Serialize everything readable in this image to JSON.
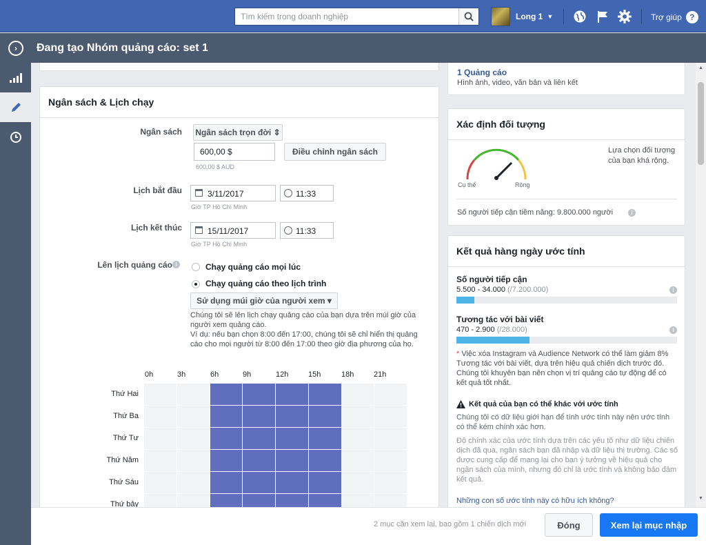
{
  "topbar": {
    "search_placeholder": "Tìm kiếm trong doanh nghiệp",
    "user_name": "Long 1",
    "help_label": "Trợ giúp"
  },
  "titlebar": {
    "title": "Đang tạo Nhóm quảng cáo: set 1"
  },
  "budget": {
    "heading": "Ngân sách & Lịch chạy",
    "budget_label": "Ngân sách",
    "budget_type": "Ngân sách trọn đời ⇕",
    "amount": "600,00 $",
    "amount_hint": "600,00 $ AUD",
    "adjust_button": "Điều chỉnh ngân sách",
    "start_label": "Lịch bắt đầu",
    "start_date": "3/11/2017",
    "start_time": "11:33",
    "start_tz": "Giờ TP Hồ Chí Minh",
    "end_label": "Lịch kết thúc",
    "end_date": "15/11/2017",
    "end_time": "11:33",
    "end_tz": "Giờ TP Hồ Chí Minh",
    "schedule_label": "Lên lịch quảng cáo",
    "option_always": "Chạy quảng cáo mọi lúc",
    "option_schedule": "Chạy quảng cáo theo lịch trình",
    "timezone_select": "Sử dụng múi giờ của người xem ▾",
    "desc1": "Chúng tôi sẽ lên lịch chạy quảng cáo của bạn dựa trên múi giờ của người xem quảng cáo.",
    "desc2": "Ví dụ: nếu bạn chọn 8:00 đến 17:00, chúng tôi sẽ chỉ hiển thị quảng cáo cho mọi người từ 8:00 đến 17:00 theo giờ địa phương của họ.",
    "hours": [
      "0h",
      "3h",
      "6h",
      "9h",
      "12h",
      "15h",
      "18h",
      "21h"
    ],
    "days": [
      "Thứ Hai",
      "Thứ Ba",
      "Thứ Tư",
      "Thứ Năm",
      "Thứ Sáu",
      "Thứ bảy"
    ],
    "scheduled_from_cell": 3,
    "scheduled_to_cell": 7
  },
  "right": {
    "ads_link": "1 Quảng cáo",
    "ads_sub": "Hình ảnh, video, văn bản và liên kết",
    "audience_heading": "Xác định đối tượng",
    "gauge_left": "Cụ thể",
    "gauge_right": "Rộng",
    "audience_desc": "Lựa chọn đối tượng của bạn khá rộng.",
    "reach_text": "Số người tiếp cận tiềm năng: 9.800.000 người",
    "results_heading": "Kết quả hàng ngày ước tính",
    "reach_label": "Số người tiếp cận",
    "reach_range": "5.500 - 34.000",
    "reach_total": "(/7.200.000)",
    "reach_fraction": 0.08,
    "engage_label": "Tương tác với bài viết",
    "engage_range": "470 - 2.900",
    "engage_total": "(/28.000)",
    "engage_fraction": 0.33,
    "note1": "Việc xóa Instagram và Audience Network có thể làm giảm 8% Tương tác với bài viết, dựa trên hiệu quả chiến dịch trước đó. Chúng tôi khuyên bạn nên chọn vị trí quảng cáo tự động để có kết quả tốt nhất.",
    "warn_title": "Kết quả của bạn có thể khác với ước tính",
    "warn_desc1": "Chúng tôi có dữ liệu giới hạn để tính ước tính này nên ước tính có thể kém chính xác hơn.",
    "warn_desc2": "Độ chính xác của ước tính dựa trên các yếu tố như dữ liệu chiến dịch đã qua, ngân sách bạn đã nhập và dữ liệu thị trường. Các số được cung cấp để mang lại cho bạn ý tưởng về hiệu quả cho ngân sách của mình, nhưng đó chỉ là ước tính và không bảo đảm kết quả.",
    "useful_link": "Những con số ước tính này có hữu ích không?"
  },
  "footer": {
    "message": "2 mục cần xem lại, bao gồm 1 chiến dịch mới",
    "close_button": "Đóng",
    "review_button": "Xem lại mục nhập"
  }
}
